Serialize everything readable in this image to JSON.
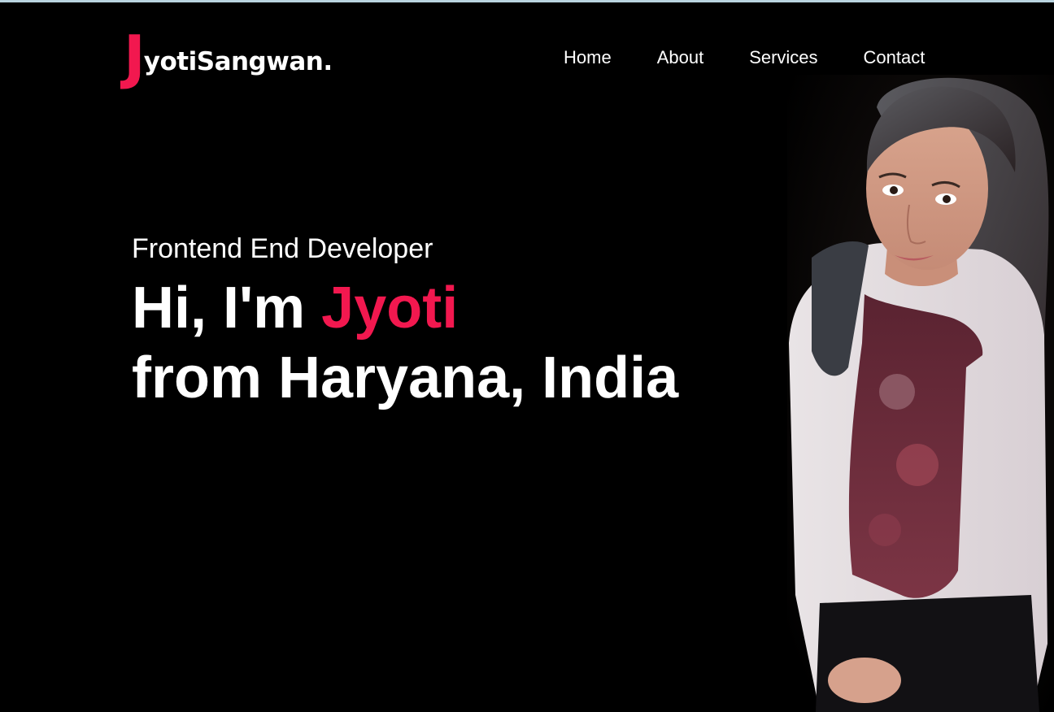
{
  "logo": {
    "initial": "J",
    "rest": "yotiSangwan."
  },
  "nav": {
    "items": [
      {
        "label": "Home"
      },
      {
        "label": "About"
      },
      {
        "label": "Services"
      },
      {
        "label": "Contact"
      }
    ]
  },
  "hero": {
    "role": "Frontend End Developer",
    "greeting": "Hi, I'm ",
    "name": "Jyoti",
    "location": "from Haryana, India"
  },
  "colors": {
    "accent": "#f2184f",
    "background": "#000000",
    "text": "#ffffff"
  }
}
